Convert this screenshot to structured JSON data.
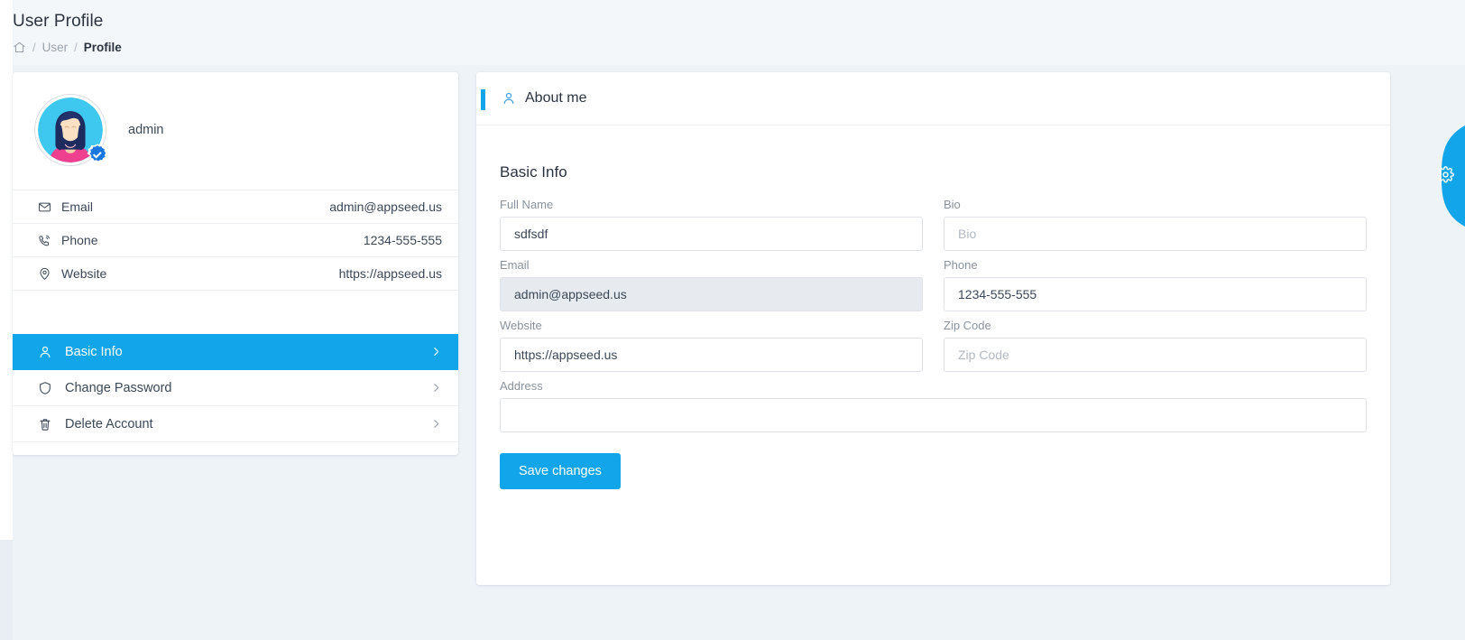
{
  "page": {
    "title": "User Profile",
    "breadcrumb": {
      "home_icon": "home-icon",
      "sep": "/",
      "items": [
        "User",
        "Profile"
      ]
    },
    "accent_color": "#13a5e9",
    "background_color": "#eef3f8"
  },
  "profile_card": {
    "avatar_icon": "user-avatar-illustration",
    "verified_icon": "verified-badge-icon",
    "username": "admin",
    "info": [
      {
        "icon": "mail-icon",
        "label": "Email",
        "value": "admin@appseed.us"
      },
      {
        "icon": "phone-icon",
        "label": "Phone",
        "value": "1234-555-555"
      },
      {
        "icon": "location-icon",
        "label": "Website",
        "value": "https://appseed.us"
      }
    ],
    "menu": [
      {
        "icon": "user-icon",
        "label": "Basic Info",
        "active": true,
        "chevron": "chevron-right-icon"
      },
      {
        "icon": "shield-icon",
        "label": "Change Password",
        "active": false,
        "chevron": "chevron-right-icon"
      },
      {
        "icon": "trash-icon",
        "label": "Delete Account",
        "active": false,
        "chevron": "chevron-right-icon"
      }
    ]
  },
  "about_card": {
    "header_icon": "user-icon",
    "header_title": "About me",
    "section_title": "Basic Info",
    "fields": {
      "full_name": {
        "label": "Full Name",
        "value": "sdfsdf",
        "placeholder": ""
      },
      "bio": {
        "label": "Bio",
        "value": "",
        "placeholder": "Bio"
      },
      "email": {
        "label": "Email",
        "value": "admin@appseed.us",
        "placeholder": "",
        "disabled": true
      },
      "phone": {
        "label": "Phone",
        "value": "1234-555-555",
        "placeholder": ""
      },
      "website": {
        "label": "Website",
        "value": "https://appseed.us",
        "placeholder": ""
      },
      "zip_code": {
        "label": "Zip Code",
        "value": "",
        "placeholder": "Zip Code"
      },
      "address": {
        "label": "Address",
        "value": "",
        "placeholder": ""
      }
    },
    "save_label": "Save changes"
  },
  "settings_tab": {
    "icon": "gear-icon"
  }
}
